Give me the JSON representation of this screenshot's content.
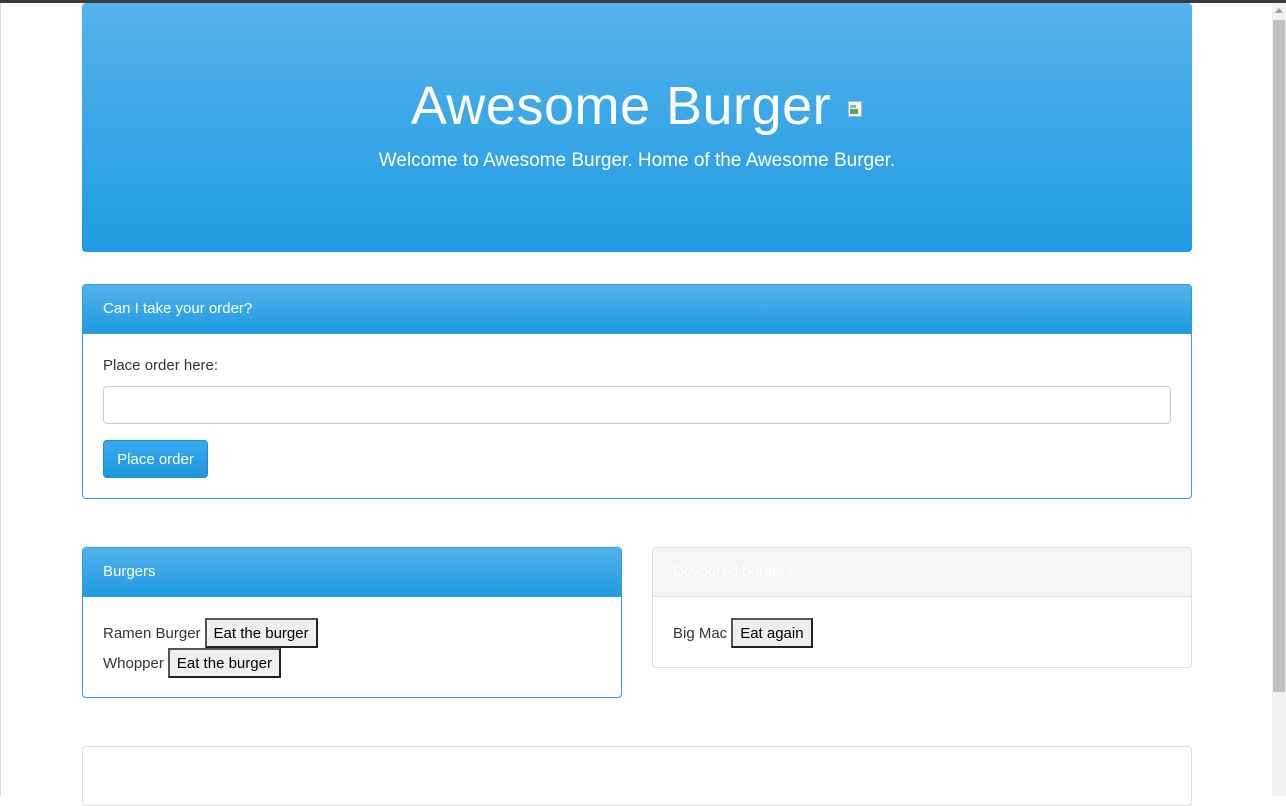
{
  "jumbotron": {
    "title": "Awesome Burger",
    "subtitle": "Welcome to Awesome Burger. Home of the Awesome Burger."
  },
  "order_panel": {
    "heading": "Can I take your order?",
    "label": "Place order here:",
    "input_value": "",
    "button_label": "Place order"
  },
  "burgers_panel": {
    "heading": "Burgers",
    "items": [
      {
        "name": "Ramen Burger",
        "button": "Eat the burger"
      },
      {
        "name": "Whopper",
        "button": "Eat the burger"
      }
    ]
  },
  "devoured_panel": {
    "heading": "Devoured burgers",
    "items": [
      {
        "name": "Big Mac",
        "button": "Eat again"
      }
    ]
  },
  "colors": {
    "brand_blue": "#1f9be3",
    "brand_blue_light": "#54b2ea"
  },
  "icons": {
    "broken_image": "broken-image-icon"
  }
}
